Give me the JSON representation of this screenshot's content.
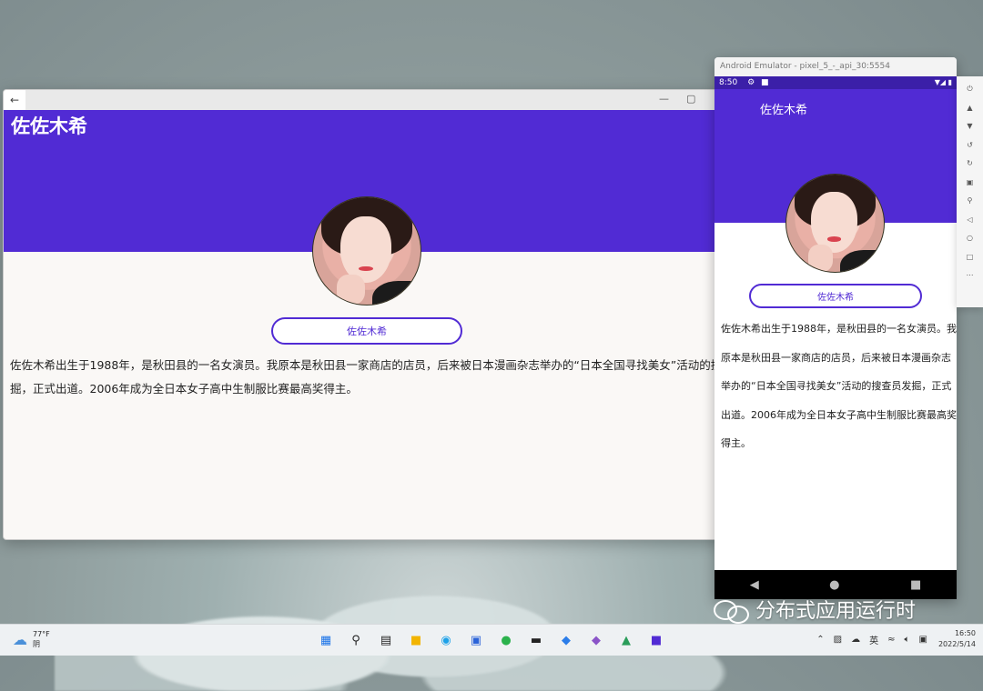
{
  "desktop_window": {
    "back_icon": "back-arrow-icon",
    "minimize_icon": "minimize-icon",
    "maximize_icon": "maximize-icon",
    "page_title": "佐佐木希",
    "name_button_label": "佐佐木希",
    "bio_line1": "佐佐木希出生于1988年，是秋田县的一名女演员。我原本是秋田县一家商店的店员，后来被日本漫画杂志举办的“日本全国寻找美女”活动的搜查员发",
    "bio_line2": "掘，正式出道。2006年成为全日本女子高中生制服比赛最高奖得主。",
    "colors": {
      "accent": "#512bd4",
      "background": "#faf8f6"
    }
  },
  "emulator": {
    "window_title": "Android Emulator - pixel_5_-_api_30:5554",
    "status_time": "8:50",
    "app_title": "佐佐木希",
    "name_button_label": "佐佐木希",
    "bio_lines": [
      "佐佐木希出生于1988年，是秋田县的一名女演员。我",
      "原本是秋田县一家商店的店员，后来被日本漫画杂志",
      "举办的“日本全国寻找美女”活动的搜查员发掘，正式",
      "出道。2006年成为全日本女子高中生制服比赛最高奖",
      "得主。"
    ],
    "nav_icons": [
      "back-triangle-icon",
      "home-circle-icon",
      "recents-square-icon"
    ],
    "side_toolbar_icons": [
      "power-icon",
      "volume-up-icon",
      "volume-down-icon",
      "rotate-left-icon",
      "rotate-right-icon",
      "camera-icon",
      "zoom-icon",
      "back-icon",
      "home-icon",
      "overview-icon",
      "more-icon"
    ]
  },
  "watermark": {
    "text": "分布式应用运行时"
  },
  "taskbar": {
    "weather_temp": "77°F",
    "weather_desc": "阴",
    "ime_label": "英",
    "time": "16:50",
    "date": "2022/5/14"
  }
}
